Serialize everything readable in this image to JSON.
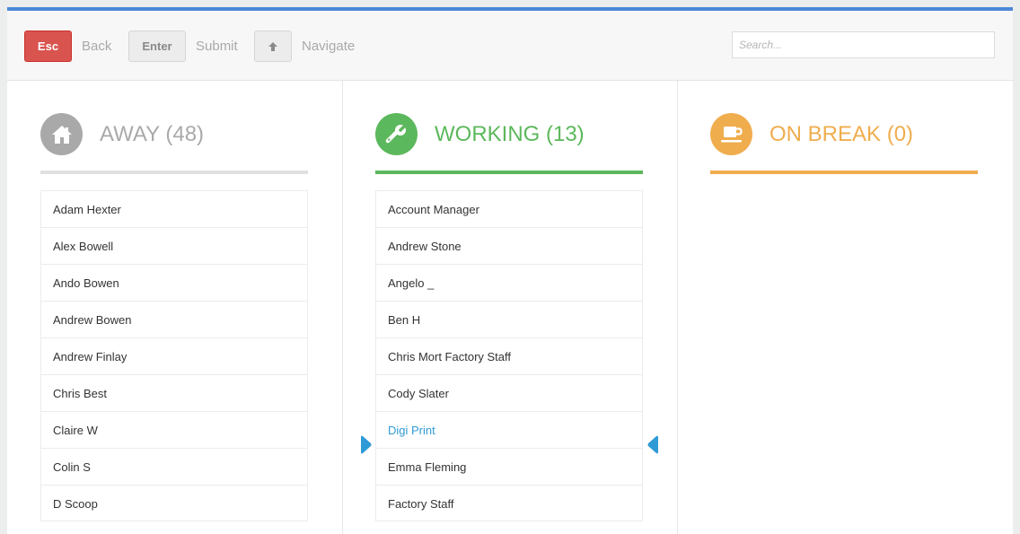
{
  "toolbar": {
    "esc_key": "Esc",
    "back_label": "Back",
    "enter_key": "Enter",
    "submit_label": "Submit",
    "navigate_label": "Navigate",
    "search_placeholder": "Search..."
  },
  "columns": [
    {
      "title": "AWAY (48)",
      "icon": "home-icon",
      "color": "#a9a9a9",
      "underline_color": "#e0e0e0",
      "items": [
        "Adam Hexter",
        "Alex Bowell",
        "Ando Bowen",
        "Andrew Bowen",
        "Andrew Finlay",
        "Chris Best",
        "Claire W",
        "Colin S",
        "D Scoop"
      ]
    },
    {
      "title": "WORKING (13)",
      "icon": "wrench-icon",
      "color": "#5cb85c",
      "underline_color": "#5cb85c",
      "items": [
        "Account Manager",
        "Andrew Stone",
        "Angelo _",
        "Ben H",
        "Chris Mort Factory Staff",
        "Cody Slater",
        "Digi Print",
        "Emma Fleming",
        "Factory Staff"
      ],
      "selected": "Digi Print"
    },
    {
      "title": "ON BREAK (0)",
      "icon": "coffee-cup-icon",
      "color": "#f0ad4e",
      "underline_color": "#f0ad4e",
      "items": []
    }
  ],
  "colors": {
    "accent_top_bar": "#4a88d6",
    "esc_button": "#d9534f",
    "selection": "#2f9ad6"
  }
}
